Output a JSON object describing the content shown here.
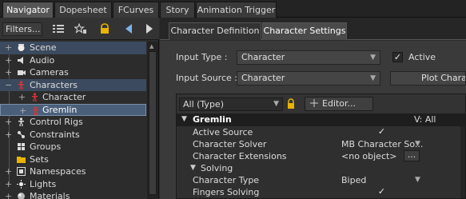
{
  "top_tabs": [
    "Navigator",
    "Dopesheet",
    "FCurves",
    "Story",
    "Animation Trigger"
  ],
  "navigator": {
    "filters_label": "Filters...",
    "tree": [
      {
        "label": "Scene",
        "icon": "scene-icon"
      },
      {
        "label": "Audio",
        "icon": "audio-icon"
      },
      {
        "label": "Cameras",
        "icon": "camera-icon"
      },
      {
        "label": "Characters",
        "icon": "characters-icon"
      },
      {
        "label": "Character",
        "icon": "character-icon"
      },
      {
        "label": "Gremlin",
        "icon": "character-icon"
      },
      {
        "label": "Control Rigs",
        "icon": "control-rig-icon"
      },
      {
        "label": "Constraints",
        "icon": "constraint-icon"
      },
      {
        "label": "Groups",
        "icon": "group-icon"
      },
      {
        "label": "Sets",
        "icon": "folder-icon"
      },
      {
        "label": "Namespaces",
        "icon": "namespace-icon"
      },
      {
        "label": "Lights",
        "icon": "light-icon"
      },
      {
        "label": "Materials",
        "icon": "material-icon"
      }
    ]
  },
  "right_panel": {
    "tabs": [
      "Character Definition",
      "Character Settings"
    ],
    "input_type_label": "Input Type :",
    "input_type_value": "Character",
    "active_label": "Active",
    "input_source_label": "Input Source :",
    "input_source_value": "Character",
    "plot_button": "Plot Charac",
    "filter_value": "All (Type)",
    "editor_button": "Editor...",
    "group_name": "Gremlin",
    "group_view": "V: All",
    "properties": [
      {
        "name": "Active Source",
        "value": ""
      },
      {
        "name": "Character Solver",
        "value": "MB Character So..."
      },
      {
        "name": "Character Extensions",
        "value": "<no object>"
      },
      {
        "name": "Solving",
        "value": ""
      },
      {
        "name": "Character Type",
        "value": "Biped"
      },
      {
        "name": "Fingers Solving",
        "value": ""
      }
    ]
  },
  "colors": {
    "selection": "#4a5f7a",
    "background": "#2b2b2b",
    "panel": "#3a3a3a"
  }
}
